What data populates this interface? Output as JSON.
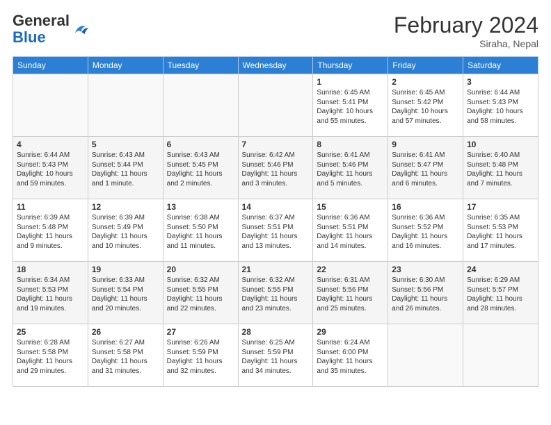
{
  "header": {
    "logo_general": "General",
    "logo_blue": "Blue",
    "month_year": "February 2024",
    "location": "Siraha, Nepal"
  },
  "days_of_week": [
    "Sunday",
    "Monday",
    "Tuesday",
    "Wednesday",
    "Thursday",
    "Friday",
    "Saturday"
  ],
  "weeks": [
    [
      {
        "day": "",
        "info": ""
      },
      {
        "day": "",
        "info": ""
      },
      {
        "day": "",
        "info": ""
      },
      {
        "day": "",
        "info": ""
      },
      {
        "day": "1",
        "info": "Sunrise: 6:45 AM\nSunset: 5:41 PM\nDaylight: 10 hours and 55 minutes."
      },
      {
        "day": "2",
        "info": "Sunrise: 6:45 AM\nSunset: 5:42 PM\nDaylight: 10 hours and 57 minutes."
      },
      {
        "day": "3",
        "info": "Sunrise: 6:44 AM\nSunset: 5:43 PM\nDaylight: 10 hours and 58 minutes."
      }
    ],
    [
      {
        "day": "4",
        "info": "Sunrise: 6:44 AM\nSunset: 5:43 PM\nDaylight: 10 hours and 59 minutes."
      },
      {
        "day": "5",
        "info": "Sunrise: 6:43 AM\nSunset: 5:44 PM\nDaylight: 11 hours and 1 minute."
      },
      {
        "day": "6",
        "info": "Sunrise: 6:43 AM\nSunset: 5:45 PM\nDaylight: 11 hours and 2 minutes."
      },
      {
        "day": "7",
        "info": "Sunrise: 6:42 AM\nSunset: 5:46 PM\nDaylight: 11 hours and 3 minutes."
      },
      {
        "day": "8",
        "info": "Sunrise: 6:41 AM\nSunset: 5:46 PM\nDaylight: 11 hours and 5 minutes."
      },
      {
        "day": "9",
        "info": "Sunrise: 6:41 AM\nSunset: 5:47 PM\nDaylight: 11 hours and 6 minutes."
      },
      {
        "day": "10",
        "info": "Sunrise: 6:40 AM\nSunset: 5:48 PM\nDaylight: 11 hours and 7 minutes."
      }
    ],
    [
      {
        "day": "11",
        "info": "Sunrise: 6:39 AM\nSunset: 5:48 PM\nDaylight: 11 hours and 9 minutes."
      },
      {
        "day": "12",
        "info": "Sunrise: 6:39 AM\nSunset: 5:49 PM\nDaylight: 11 hours and 10 minutes."
      },
      {
        "day": "13",
        "info": "Sunrise: 6:38 AM\nSunset: 5:50 PM\nDaylight: 11 hours and 11 minutes."
      },
      {
        "day": "14",
        "info": "Sunrise: 6:37 AM\nSunset: 5:51 PM\nDaylight: 11 hours and 13 minutes."
      },
      {
        "day": "15",
        "info": "Sunrise: 6:36 AM\nSunset: 5:51 PM\nDaylight: 11 hours and 14 minutes."
      },
      {
        "day": "16",
        "info": "Sunrise: 6:36 AM\nSunset: 5:52 PM\nDaylight: 11 hours and 16 minutes."
      },
      {
        "day": "17",
        "info": "Sunrise: 6:35 AM\nSunset: 5:53 PM\nDaylight: 11 hours and 17 minutes."
      }
    ],
    [
      {
        "day": "18",
        "info": "Sunrise: 6:34 AM\nSunset: 5:53 PM\nDaylight: 11 hours and 19 minutes."
      },
      {
        "day": "19",
        "info": "Sunrise: 6:33 AM\nSunset: 5:54 PM\nDaylight: 11 hours and 20 minutes."
      },
      {
        "day": "20",
        "info": "Sunrise: 6:32 AM\nSunset: 5:55 PM\nDaylight: 11 hours and 22 minutes."
      },
      {
        "day": "21",
        "info": "Sunrise: 6:32 AM\nSunset: 5:55 PM\nDaylight: 11 hours and 23 minutes."
      },
      {
        "day": "22",
        "info": "Sunrise: 6:31 AM\nSunset: 5:56 PM\nDaylight: 11 hours and 25 minutes."
      },
      {
        "day": "23",
        "info": "Sunrise: 6:30 AM\nSunset: 5:56 PM\nDaylight: 11 hours and 26 minutes."
      },
      {
        "day": "24",
        "info": "Sunrise: 6:29 AM\nSunset: 5:57 PM\nDaylight: 11 hours and 28 minutes."
      }
    ],
    [
      {
        "day": "25",
        "info": "Sunrise: 6:28 AM\nSunset: 5:58 PM\nDaylight: 11 hours and 29 minutes."
      },
      {
        "day": "26",
        "info": "Sunrise: 6:27 AM\nSunset: 5:58 PM\nDaylight: 11 hours and 31 minutes."
      },
      {
        "day": "27",
        "info": "Sunrise: 6:26 AM\nSunset: 5:59 PM\nDaylight: 11 hours and 32 minutes."
      },
      {
        "day": "28",
        "info": "Sunrise: 6:25 AM\nSunset: 5:59 PM\nDaylight: 11 hours and 34 minutes."
      },
      {
        "day": "29",
        "info": "Sunrise: 6:24 AM\nSunset: 6:00 PM\nDaylight: 11 hours and 35 minutes."
      },
      {
        "day": "",
        "info": ""
      },
      {
        "day": "",
        "info": ""
      }
    ]
  ]
}
